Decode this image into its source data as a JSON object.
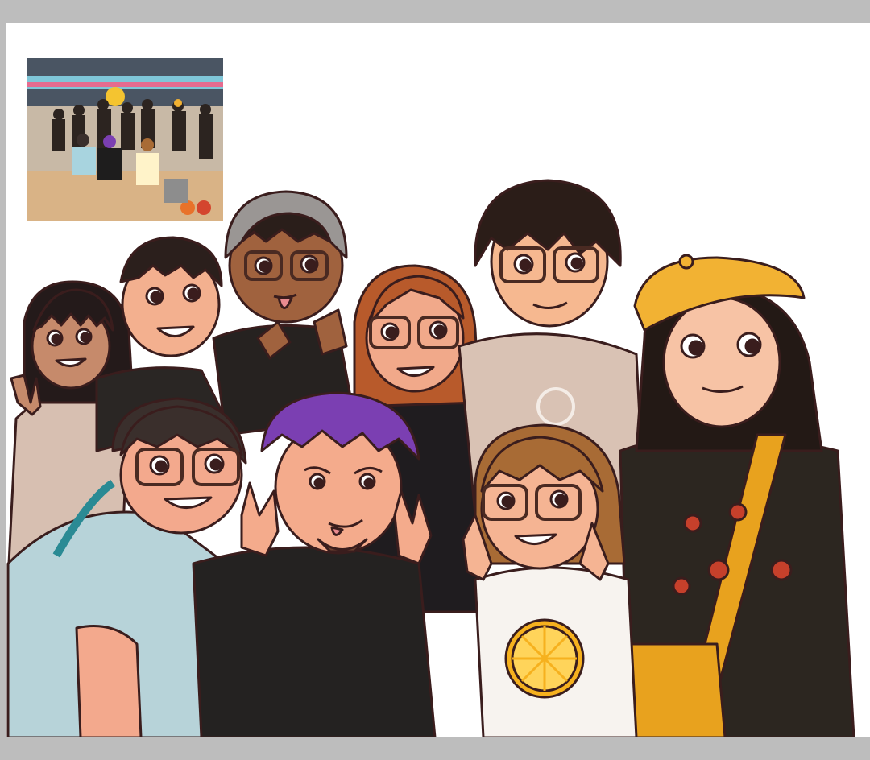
{
  "artwork": {
    "subject": "cartoon-group-portrait",
    "reference_photo": "bowling-alley-group-photo",
    "colors": {
      "page_gray": "#bdbdbd",
      "canvas": "#ffffff",
      "beret_yellow": "#f2b233",
      "purple_hair": "#7b3fb2",
      "lemon": "#f6b11e",
      "outline": "#3a1d1d"
    }
  }
}
